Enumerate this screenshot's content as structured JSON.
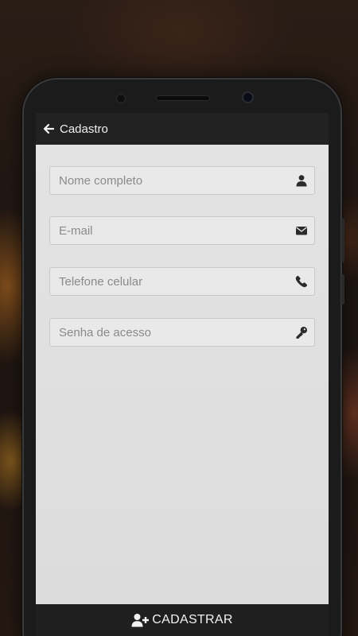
{
  "appbar": {
    "title": "Cadastro",
    "back_icon": "arrow-left-icon"
  },
  "form": {
    "fields": [
      {
        "placeholder": "Nome completo",
        "icon": "user-icon"
      },
      {
        "placeholder": "E-mail",
        "icon": "envelope-icon"
      },
      {
        "placeholder": "Telefone celular",
        "icon": "phone-icon"
      },
      {
        "placeholder": "Senha de acesso",
        "icon": "key-icon"
      }
    ]
  },
  "action": {
    "label": "CADASTRAR",
    "icon": "user-plus-icon"
  },
  "colors": {
    "appbar": "#222222",
    "screen_background": "#e3e3e3",
    "field_background": "#e9e9e9",
    "button_bar": "#1f1f1f"
  }
}
